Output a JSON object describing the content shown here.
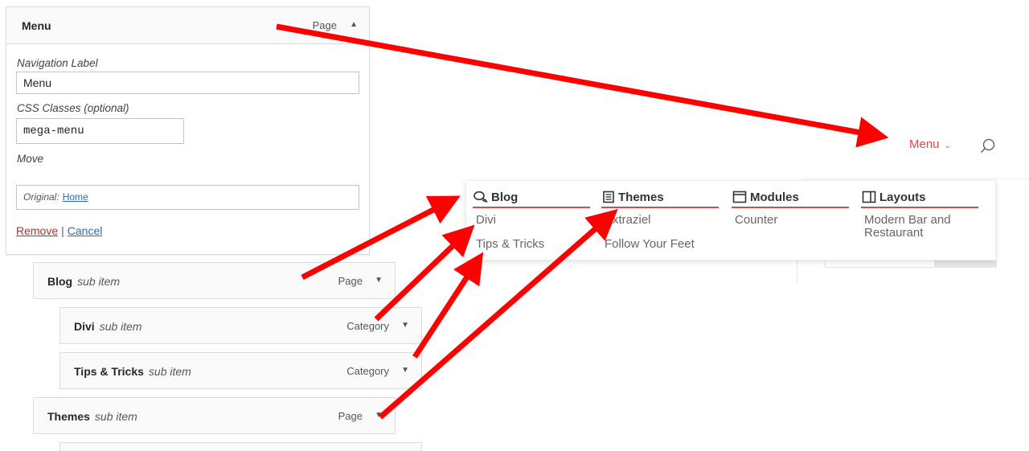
{
  "admin_item": {
    "title": "Menu",
    "type": "Page",
    "nav_label_caption": "Navigation Label",
    "nav_label_value": "Menu",
    "css_classes_caption": "CSS Classes (optional)",
    "css_classes_value": "mega-menu",
    "move_caption": "Move",
    "original_caption": "Original:",
    "original_link": "Home",
    "remove_label": "Remove",
    "separator": "|",
    "cancel_label": "Cancel"
  },
  "sub_items": [
    {
      "title": "Blog",
      "suffix": "sub item",
      "type": "Page"
    },
    {
      "title": "Divi",
      "suffix": "sub item",
      "type": "Category"
    },
    {
      "title": "Tips & Tricks",
      "suffix": "sub item",
      "type": "Category"
    },
    {
      "title": "Themes",
      "suffix": "sub item",
      "type": "Page"
    }
  ],
  "frontend": {
    "menu_label": "Menu",
    "accent_color": "#e8434a",
    "columns": [
      {
        "heading": "Blog",
        "icon": "chat-bubbles-icon",
        "links": [
          "Divi",
          "Tips & Tricks"
        ]
      },
      {
        "heading": "Themes",
        "icon": "book-icon",
        "links": [
          "Extraziel",
          "Follow Your Feet"
        ]
      },
      {
        "heading": "Modules",
        "icon": "window-icon",
        "links": [
          "Counter"
        ]
      },
      {
        "heading": "Layouts",
        "icon": "layout-icon",
        "links": [
          "Modern Bar and Restaurant"
        ]
      }
    ]
  },
  "annotation_color": "#ff0000"
}
